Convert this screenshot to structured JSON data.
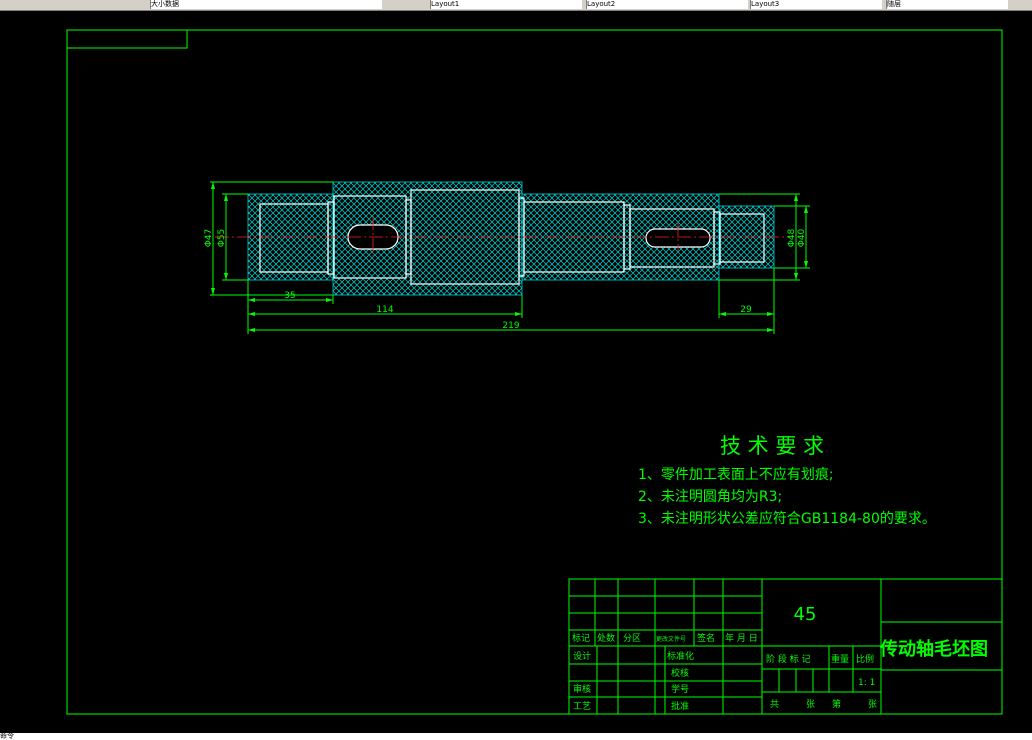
{
  "topbar": {
    "items": [
      {
        "label": "大小数据"
      },
      {
        "label": "Layout1"
      },
      {
        "label": "Layout2"
      },
      {
        "label": "Layout3"
      },
      {
        "label": "随层"
      }
    ]
  },
  "status": {
    "text": "命令"
  },
  "drawing": {
    "dims": {
      "d1": "Φ47",
      "d2": "Φ55",
      "d3": "Φ48",
      "d4": "Φ40",
      "l1": "35",
      "l2": "114",
      "l3": "219",
      "l4": "29"
    }
  },
  "notes": {
    "title": "技 术 要 求",
    "items": [
      "1、零件加工表面上不应有划痕;",
      "2、未注明圆角均为R3;",
      "3、未注明形状公差应符合GB1184-80的要求。"
    ]
  },
  "title_block": {
    "material": "45",
    "part_name": "传动轴毛坯图",
    "scale": "1: 1",
    "header": [
      "标记",
      "处数",
      "分区",
      "更改文件号",
      "签名",
      "年 月 日"
    ],
    "rows": [
      "设计",
      "标准化",
      "校核",
      "审核",
      "学号",
      "工艺",
      "批准"
    ],
    "stage_labels": [
      "阶 段 标 记",
      "重量",
      "比例"
    ],
    "sheets": [
      "共",
      "张",
      "第",
      "张"
    ]
  },
  "colors": {
    "frame": "#00ff00",
    "shaft": "#ffffff",
    "center": "#ff2020",
    "hatch": "#00d8d8",
    "text": "#00ff00"
  }
}
